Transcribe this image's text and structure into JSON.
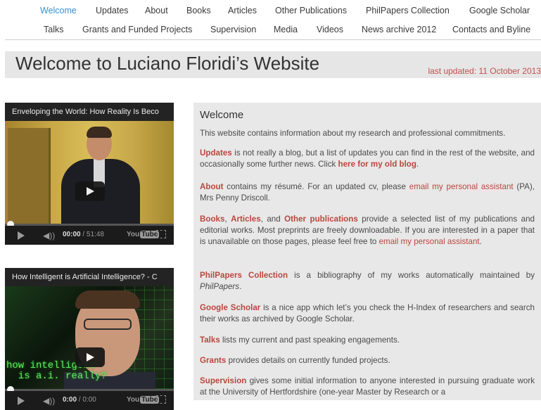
{
  "nav": {
    "row1": [
      {
        "label": "Welcome",
        "active": true
      },
      {
        "label": "Updates"
      },
      {
        "label": "About"
      },
      {
        "label": "Books"
      },
      {
        "label": "Articles"
      },
      {
        "label": "Other Publications"
      },
      {
        "label": "PhilPapers Collection"
      },
      {
        "label": "Google Scholar"
      }
    ],
    "row2": [
      {
        "label": "Talks"
      },
      {
        "label": "Grants and Funded Projects"
      },
      {
        "label": "Supervision"
      },
      {
        "label": "Media"
      },
      {
        "label": "Videos"
      },
      {
        "label": "News archive 2012"
      },
      {
        "label": "Contacts and Byline"
      }
    ]
  },
  "page": {
    "title": "Welcome to Luciano Floridi’s Website",
    "last_updated": "last updated: 11 October 2013"
  },
  "videos": [
    {
      "title": "Enveloping the World: How Reality Is Beco",
      "current_time": "00:00",
      "duration": "/ 51:48",
      "logo": "You",
      "logo_tube": "Tube"
    },
    {
      "title": "How Intelligent is Artificial Intelligence? - C",
      "overlay_text": "how intelligent\n  is a.i. really?",
      "current_time": "0:00",
      "duration": "/ 0:00",
      "logo": "You",
      "logo_tube": "Tube"
    }
  ],
  "content": {
    "heading": "Welcome",
    "p1": "This website contains information about my research and professional commitments.",
    "p2": {
      "updates": "Updates",
      "text": " is not really a blog, but a list of updates you can find in the rest of the website, and occasionally some further news. Click ",
      "link": "here for my old blog",
      "end": "."
    },
    "p3": {
      "about": "About",
      "text": " contains my résumé. For an updated cv, please ",
      "link": "email my personal assistant",
      "end": " (PA), Mrs Penny Driscoll."
    },
    "p4": {
      "books": "Books",
      "sep1": ", ",
      "articles": "Articles",
      "sep2": ", and ",
      "other": "Other publications",
      "text": " provide a selected list of my publications and editorial works. Most preprints are freely downloadable. If you are interested in a paper that is unavailable on those pages, please feel free to ",
      "link": "email my personal assistant",
      "end": "."
    },
    "p5": {
      "philpapers": "PhilPapers Collection",
      "text": " is a bibliography of my works automatically maintained by ",
      "italic": "PhilPapers",
      "end": "."
    },
    "p6": {
      "scholar": "Google Scholar",
      "text": " is a nice app which let’s you check the H-Index of researchers and search their works as archived by Google Scholar."
    },
    "p7": {
      "talks": "Talks",
      "text": " lists my current and past speaking engagements."
    },
    "p8": {
      "grants": "Grants",
      "text": " provides details on currently funded projects."
    },
    "p9": {
      "supervision": "Supervision",
      "text": " gives some initial information to anyone interested in pursuing graduate work at the University of Hertfordshire (one-year Master by Research or a"
    }
  },
  "colors": {
    "accent_link": "#b9473e",
    "active_nav": "#3a8fcf",
    "title_bar_bg": "#e6e6e6",
    "content_bg": "#e8e8e8"
  }
}
